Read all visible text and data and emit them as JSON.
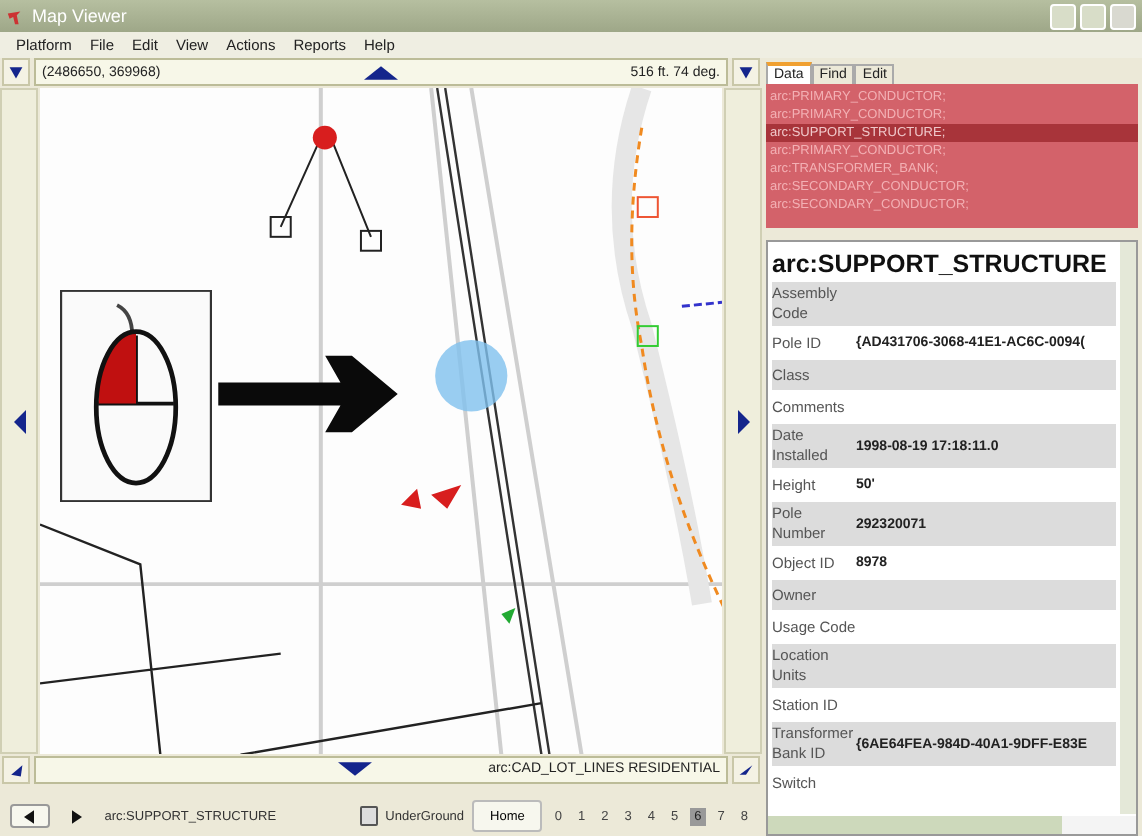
{
  "window": {
    "title": "Map Viewer"
  },
  "menu": [
    "Platform",
    "File",
    "Edit",
    "View",
    "Actions",
    "Reports",
    "Help"
  ],
  "map": {
    "coordinates": "(2486650, 369968)",
    "scale_heading": "516 ft. 74 deg.",
    "layer_label": "arc:CAD_LOT_LINES RESIDENTIAL",
    "kind": "picture"
  },
  "footer": {
    "current_feature": "arc:SUPPORT_STRUCTURE",
    "underground": {
      "label": "UnderGround",
      "checked": false
    },
    "home": "Home",
    "zoom_levels": [
      {
        "label": "0",
        "selected": false
      },
      {
        "label": "1",
        "selected": false
      },
      {
        "label": "2",
        "selected": false
      },
      {
        "label": "3",
        "selected": false
      },
      {
        "label": "4",
        "selected": false
      },
      {
        "label": "5",
        "selected": false
      },
      {
        "label": "6",
        "selected": true
      },
      {
        "label": "7",
        "selected": false
      },
      {
        "label": "8",
        "selected": false
      }
    ]
  },
  "panel": {
    "tabs": [
      {
        "label": "Data",
        "selected": true
      },
      {
        "label": "Find",
        "selected": false
      },
      {
        "label": "Edit",
        "selected": false
      }
    ],
    "results": [
      {
        "text": "arc:PRIMARY_CONDUCTOR;",
        "selected": false
      },
      {
        "text": "arc:PRIMARY_CONDUCTOR;",
        "selected": false
      },
      {
        "text": "arc:SUPPORT_STRUCTURE;",
        "selected": true
      },
      {
        "text": "arc:PRIMARY_CONDUCTOR;",
        "selected": false
      },
      {
        "text": "arc:TRANSFORMER_BANK;",
        "selected": false
      },
      {
        "text": "arc:SECONDARY_CONDUCTOR;",
        "selected": false
      },
      {
        "text": "arc:SECONDARY_CONDUCTOR;",
        "selected": false
      }
    ],
    "heading": "arc:SUPPORT_STRUCTURE",
    "attributes": [
      {
        "label": "Assembly Code"
      },
      {
        "label": "Pole ID",
        "value": "{AD431706-3068-41E1-AC6C-0094("
      },
      {
        "label": "Class"
      },
      {
        "label": "Comments"
      },
      {
        "label": "Date Installed",
        "value": "1998-08-19 17:18:11.0"
      },
      {
        "label": "Height",
        "value": "50'"
      },
      {
        "label": "Pole Number",
        "value": "292320071"
      },
      {
        "label": "Object ID",
        "value": "8978"
      },
      {
        "label": "Owner"
      },
      {
        "label": "Usage Code"
      },
      {
        "label": "Location Units"
      },
      {
        "label": "Station ID"
      },
      {
        "label": "Transformer Bank ID",
        "value": "{6AE64FEA-984D-40A1-9DFF-E83E"
      },
      {
        "label": "Switch"
      }
    ]
  }
}
